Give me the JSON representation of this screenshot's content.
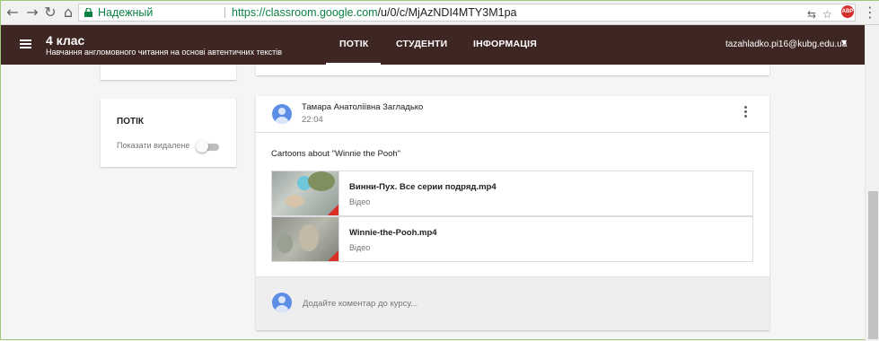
{
  "browser": {
    "secure_label": "Надежный",
    "url_host": "https://classroom.google.com",
    "url_path": "/u/0/c/MjAzNDI4MTY3M1pa",
    "adblock_label": "ABP"
  },
  "header": {
    "class_title": "4 клас",
    "class_subtitle": "Навчання англомовного читання на основі автентичних текстів",
    "tabs": [
      {
        "label": "ПОТІК",
        "active": true
      },
      {
        "label": "СТУДЕНТИ",
        "active": false
      },
      {
        "label": "ІНФОРМАЦІЯ",
        "active": false
      }
    ],
    "account": "tazahladko.pi16@kubg.edu.ua"
  },
  "sidebar": {
    "stream_label": "ПОТІК",
    "show_deleted_label": "Показати видалене",
    "show_deleted_on": false
  },
  "post": {
    "author": "Тамара Анатоліївна Загладько",
    "time": "22:04",
    "text": "Cartoons about \"Winnie the Pooh\"",
    "attachments": [
      {
        "title": "Винни-Пух. Все серии подряд.mp4",
        "type": "Відео"
      },
      {
        "title": "Winnie-the-Pooh.mp4",
        "type": "Відео"
      }
    ],
    "comment_placeholder": "Додайте коментар до курсу..."
  },
  "colors": {
    "header_bg": "#3e2723",
    "secure_green": "#0b8043",
    "avatar_blue": "#5c8ee6"
  }
}
